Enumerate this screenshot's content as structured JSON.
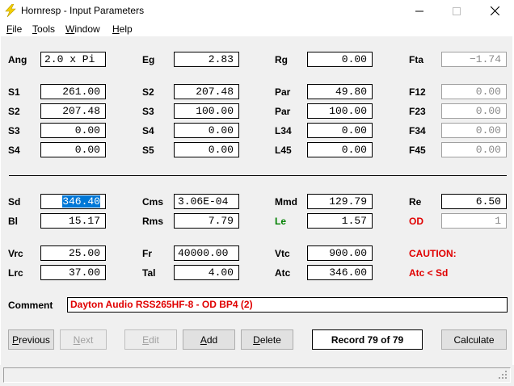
{
  "window": {
    "title": "Hornresp - Input Parameters"
  },
  "menu": [
    "File",
    "Tools",
    "Window",
    "Help"
  ],
  "params": {
    "ang": {
      "label": "Ang",
      "value": "2.0 x Pi"
    },
    "eg": {
      "label": "Eg",
      "value": "2.83"
    },
    "rg": {
      "label": "Rg",
      "value": "0.00"
    },
    "fta": {
      "label": "Fta",
      "value": "−1.74"
    },
    "s1": {
      "label": "S1",
      "value": "261.00"
    },
    "s2a": {
      "label": "S2",
      "value": "207.48"
    },
    "par1": {
      "label": "Par",
      "value": "49.80"
    },
    "f12": {
      "label": "F12",
      "value": "0.00"
    },
    "s2b": {
      "label": "S2",
      "value": "207.48"
    },
    "s3a": {
      "label": "S3",
      "value": "100.00"
    },
    "par2": {
      "label": "Par",
      "value": "100.00"
    },
    "f23": {
      "label": "F23",
      "value": "0.00"
    },
    "s3b": {
      "label": "S3",
      "value": "0.00"
    },
    "s4a": {
      "label": "S4",
      "value": "0.00"
    },
    "l34": {
      "label": "L34",
      "value": "0.00"
    },
    "f34": {
      "label": "F34",
      "value": "0.00"
    },
    "s4b": {
      "label": "S4",
      "value": "0.00"
    },
    "s5": {
      "label": "S5",
      "value": "0.00"
    },
    "l45": {
      "label": "L45",
      "value": "0.00"
    },
    "f45": {
      "label": "F45",
      "value": "0.00"
    },
    "sd": {
      "label": "Sd",
      "value": "346.40"
    },
    "cms": {
      "label": "Cms",
      "value": "3.06E-04"
    },
    "mmd": {
      "label": "Mmd",
      "value": "129.79"
    },
    "re": {
      "label": "Re",
      "value": "6.50"
    },
    "bl": {
      "label": "Bl",
      "value": "15.17"
    },
    "rms": {
      "label": "Rms",
      "value": "7.79"
    },
    "le": {
      "label": "Le",
      "value": "1.57"
    },
    "od": {
      "label": "OD",
      "value": "1"
    },
    "vrc": {
      "label": "Vrc",
      "value": "25.00"
    },
    "fr": {
      "label": "Fr",
      "value": "40000.00"
    },
    "vtc": {
      "label": "Vtc",
      "value": "900.00"
    },
    "lrc": {
      "label": "Lrc",
      "value": "37.00"
    },
    "tal": {
      "label": "Tal",
      "value": "4.00"
    },
    "atc": {
      "label": "Atc",
      "value": "346.00"
    }
  },
  "caution": {
    "title": "CAUTION:",
    "message": "Atc < Sd"
  },
  "comment": {
    "label": "Comment",
    "value": "Dayton Audio RSS265HF-8 - OD BP4 (2)"
  },
  "buttons": {
    "previous": "Previous",
    "next": "Next",
    "edit": "Edit",
    "add": "Add",
    "delete": "Delete",
    "calculate": "Calculate"
  },
  "record": "Record 79 of 79",
  "colors": {
    "accent_red": "#e00000",
    "accent_green": "#008000",
    "selection": "#0078d7"
  }
}
